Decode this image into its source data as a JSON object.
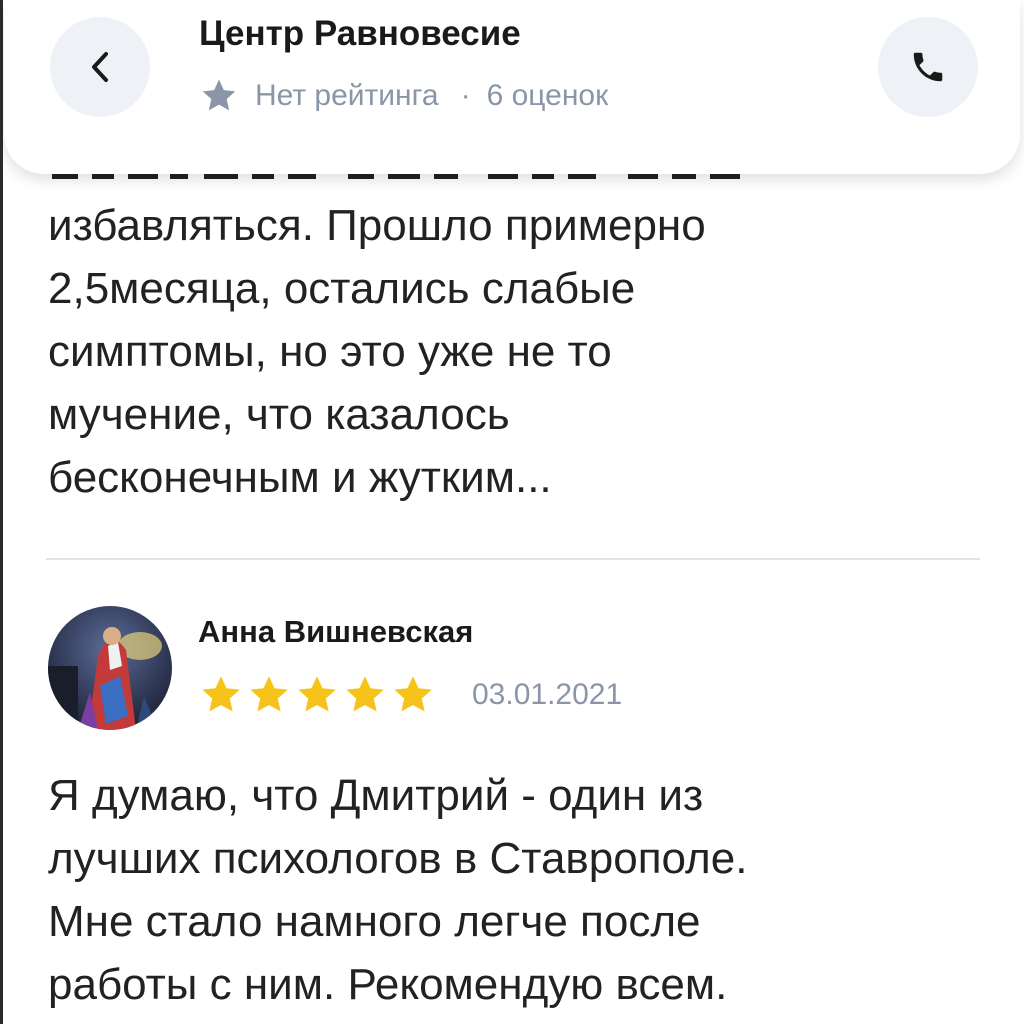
{
  "header": {
    "title": "Центр Равновесие",
    "rating_text": "Нет рейтинга",
    "separator": "·",
    "ratings_count": "6 оценок",
    "back_icon": "chevron-left-icon",
    "call_icon": "phone-icon"
  },
  "review1": {
    "lines": [
      "избавляться. Прошло примерно",
      "2,5месяца, остались слабые",
      "симптомы, но это уже не то",
      "мучение, что казалось",
      "бесконечным и жутким..."
    ]
  },
  "review2": {
    "author": "Анна Вишневская",
    "rating": 5,
    "rating_max": 5,
    "date": "03.01.2021",
    "lines": [
      "Я думаю, что Дмитрий - один из",
      "лучших психологов в Ставрополе.",
      "Мне стало намного легче после",
      "работы с ним. Рекомендую всем."
    ]
  },
  "colors": {
    "star_gold": "#f6c31a",
    "star_grey": "#8a96a8",
    "muted_text": "#8a96a8",
    "button_bg": "#eef1f6"
  }
}
